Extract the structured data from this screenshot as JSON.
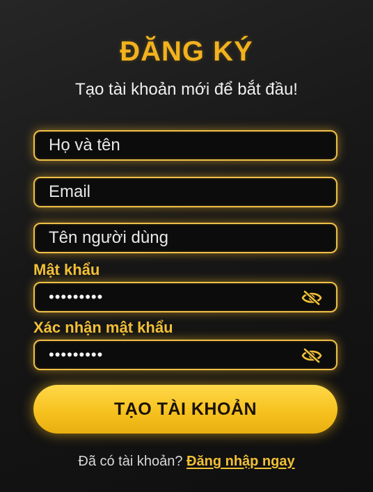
{
  "header": {
    "title": "ĐĂNG KÝ",
    "subtitle": "Tạo tài khoản mới để bắt đầu!"
  },
  "form": {
    "fullname": {
      "placeholder": "Họ và tên",
      "value": ""
    },
    "email": {
      "placeholder": "Email",
      "value": ""
    },
    "username": {
      "placeholder": "Tên người dùng",
      "value": ""
    },
    "password": {
      "label": "Mật khẩu",
      "value": "•••••••••",
      "icon": "eye-off-icon"
    },
    "confirm_password": {
      "label": "Xác nhận mật khẩu",
      "value": "•••••••••",
      "icon": "eye-off-icon"
    }
  },
  "submit": {
    "label": "TẠO TÀI KHOẢN"
  },
  "footer": {
    "prompt": "Đã có tài khoản?",
    "link": "Đăng nhập ngay"
  },
  "colors": {
    "accent": "#f2b21e",
    "field_border": "#f0c04a",
    "background": "#171717"
  }
}
